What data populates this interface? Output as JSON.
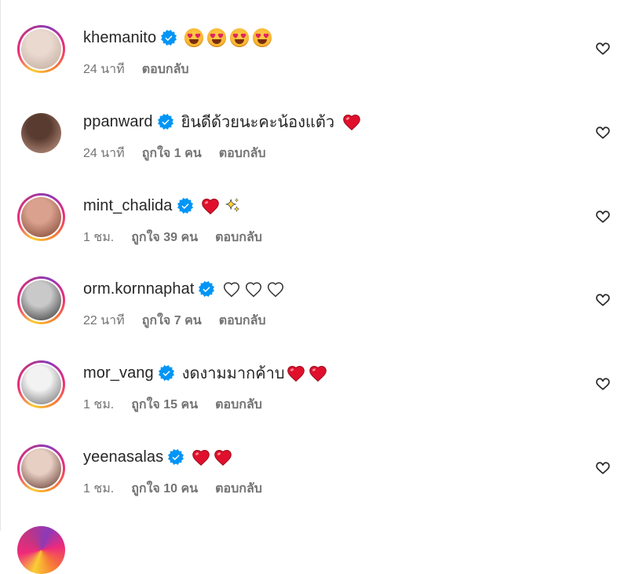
{
  "comments": [
    {
      "username": "khemanito",
      "text": "",
      "emojis": [
        "heart-eyes",
        "heart-eyes",
        "heart-eyes",
        "heart-eyes"
      ],
      "time": "24 นาที",
      "likes": "",
      "reply": "ตอบกลับ",
      "story_ring": true,
      "avatar_colors": [
        "#e9d9cf",
        "#bfa89a"
      ]
    },
    {
      "username": "ppanward",
      "text": "ยินดีด้วยนะคะน้องแต้ว",
      "emojis": [
        "red-heart"
      ],
      "time": "24 นาที",
      "likes": "ถูกใจ 1 คน",
      "reply": "ตอบกลับ",
      "story_ring": false,
      "avatar_colors": [
        "#5a3b30",
        "#c9a08c"
      ]
    },
    {
      "username": "mint_chalida",
      "text": "",
      "emojis": [
        "red-heart",
        "sparkles"
      ],
      "time": "1 ชม.",
      "likes": "ถูกใจ 39 คน",
      "reply": "ตอบกลับ",
      "story_ring": true,
      "avatar_colors": [
        "#d9a18e",
        "#7a3f2d"
      ]
    },
    {
      "username": "orm.kornnaphat",
      "text": "",
      "emojis": [
        "white-heart",
        "white-heart",
        "white-heart"
      ],
      "time": "22 นาที",
      "likes": "ถูกใจ 7 คน",
      "reply": "ตอบกลับ",
      "story_ring": true,
      "avatar_colors": [
        "#c9c9c9",
        "#2b2b2b"
      ]
    },
    {
      "username": "mor_vang",
      "text": "งดงามมากค้าบ",
      "emojis": [
        "red-heart",
        "red-heart"
      ],
      "time": "1 ชม.",
      "likes": "ถูกใจ 15 คน",
      "reply": "ตอบกลับ",
      "story_ring": true,
      "avatar_colors": [
        "#f2f2f2",
        "#6a6a6a"
      ]
    },
    {
      "username": "yeenasalas",
      "text": "",
      "emojis": [
        "red-heart",
        "red-heart"
      ],
      "time": "1 ชม.",
      "likes": "ถูกใจ 10 คน",
      "reply": "ตอบกลับ",
      "story_ring": true,
      "avatar_colors": [
        "#e8cfc4",
        "#5a2f24"
      ]
    }
  ],
  "colors": {
    "verified_blue": "#0095f6",
    "heart_red": "#ff3040",
    "muted_text": "#737373"
  }
}
